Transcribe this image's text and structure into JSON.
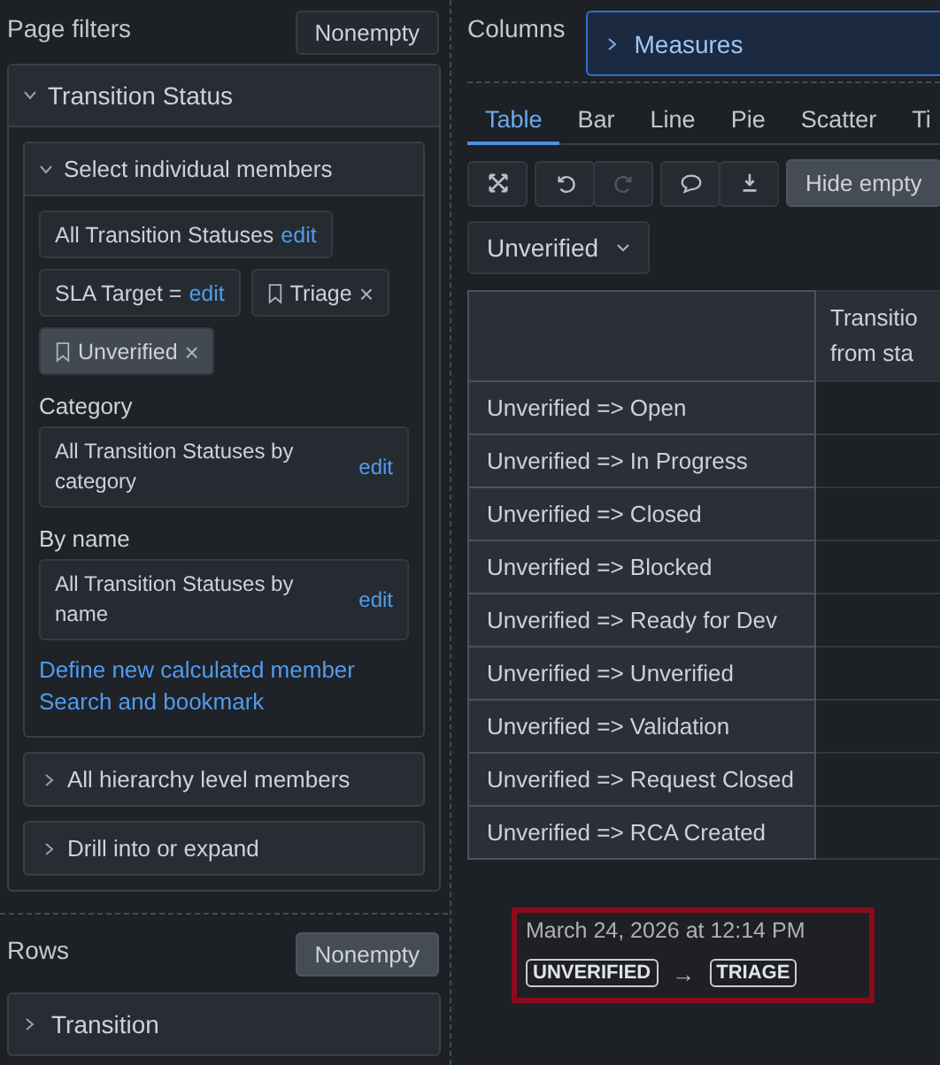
{
  "page_filters": {
    "title": "Page filters",
    "button": {
      "label": "Nonempty",
      "on": false
    }
  },
  "transition_status": {
    "title": "Transition Status",
    "expanded": true,
    "select_members": {
      "title": "Select individual members",
      "expanded": true,
      "chips": [
        {
          "kind": "all",
          "label": "All Transition Statuses",
          "link": "edit"
        },
        {
          "kind": "filter",
          "label": "SLA Target =",
          "link": "edit"
        },
        {
          "kind": "bookmark",
          "label": "Triage",
          "close": "×",
          "selected": false
        },
        {
          "kind": "bookmark",
          "label": "Unverified",
          "close": "×",
          "selected": true
        }
      ],
      "groups": [
        {
          "label": "Category",
          "value": "All Transition Statuses by category",
          "link": "edit"
        },
        {
          "label": "By name",
          "value": "All Transition Statuses by name",
          "link": "edit"
        }
      ],
      "links": [
        "Define new calculated member",
        "Search and bookmark"
      ]
    },
    "sections": [
      {
        "title": "All hierarchy level members",
        "expanded": false
      },
      {
        "title": "Drill into or expand",
        "expanded": false
      }
    ]
  },
  "rows": {
    "title": "Rows",
    "button": {
      "label": "Nonempty",
      "on": true
    },
    "items": [
      {
        "title": "Transition",
        "expanded": false
      }
    ]
  },
  "columns": {
    "title": "Columns",
    "items": [
      {
        "title": "Measures",
        "expanded": false
      }
    ]
  },
  "tabs": [
    {
      "label": "Table",
      "selected": true
    },
    {
      "label": "Bar",
      "selected": false
    },
    {
      "label": "Line",
      "selected": false
    },
    {
      "label": "Pie",
      "selected": false
    },
    {
      "label": "Scatter",
      "selected": false
    },
    {
      "label": "Ti",
      "selected": false
    }
  ],
  "toolbar": {
    "tools": [
      {
        "kind": "fullscreen",
        "disabled": false
      },
      {
        "kind": "undo",
        "disabled": false
      },
      {
        "kind": "redo",
        "disabled": true
      },
      {
        "kind": "comment",
        "disabled": false
      },
      {
        "kind": "download",
        "disabled": false
      }
    ],
    "hide_empty": "Hide empty"
  },
  "filter_dropdown": "Unverified",
  "table": {
    "column_2": "Transitio\nfrom sta",
    "rows": [
      "Unverified => Open",
      "Unverified => In Progress",
      "Unverified => Closed",
      "Unverified => Blocked",
      "Unverified => Ready for Dev",
      "Unverified => Unverified",
      "Unverified => Validation",
      "Unverified => Request Closed",
      "Unverified => RCA Created"
    ]
  },
  "tooltip": {
    "date": "March 24, 2026 at 12:14 PM",
    "from": "UNVERIFIED",
    "arrow": "→",
    "to": "TRIAGE"
  }
}
